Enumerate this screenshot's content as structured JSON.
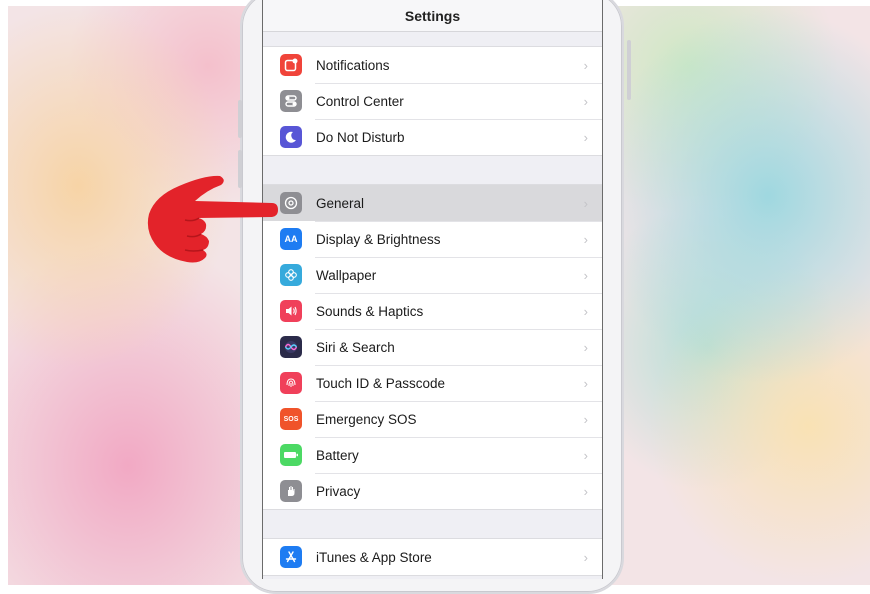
{
  "screen": {
    "title": "Settings"
  },
  "groups": [
    {
      "rows": [
        {
          "label": "Notifications",
          "icon": "notifications-icon",
          "color": "#f0443a",
          "selected": false
        },
        {
          "label": "Control Center",
          "icon": "control-center-icon",
          "color": "#8e8e93",
          "selected": false
        },
        {
          "label": "Do Not Disturb",
          "icon": "moon-icon",
          "color": "#5856d6",
          "selected": false
        }
      ]
    },
    {
      "rows": [
        {
          "label": "General",
          "icon": "gear-icon",
          "color": "#8e8e93",
          "selected": true
        },
        {
          "label": "Display & Brightness",
          "icon": "display-brightness-icon",
          "color": "#1e7cf2",
          "selected": false
        },
        {
          "label": "Wallpaper",
          "icon": "wallpaper-flower-icon",
          "color": "#36aadc",
          "selected": false
        },
        {
          "label": "Sounds & Haptics",
          "icon": "speaker-icon",
          "color": "#f0405a",
          "selected": false
        },
        {
          "label": "Siri & Search",
          "icon": "siri-icon",
          "color": "#2b2b4a",
          "selected": false
        },
        {
          "label": "Touch ID & Passcode",
          "icon": "fingerprint-icon",
          "color": "#f0405a",
          "selected": false
        },
        {
          "label": "Emergency SOS",
          "icon": "sos-icon",
          "color": "#f0532a",
          "selected": false
        },
        {
          "label": "Battery",
          "icon": "battery-icon",
          "color": "#4cd964",
          "selected": false
        },
        {
          "label": "Privacy",
          "icon": "hand-icon",
          "color": "#8e8e93",
          "selected": false
        }
      ]
    },
    {
      "rows": [
        {
          "label": "iTunes & App Store",
          "icon": "app-store-icon",
          "color": "#1e7cf2",
          "selected": false
        }
      ]
    }
  ],
  "sos_icon_text": "SOS",
  "display_icon_text": "AA",
  "chevron_glyph": "›",
  "pointer": {
    "icon": "pointing-hand-icon",
    "color": "#e3232a"
  }
}
